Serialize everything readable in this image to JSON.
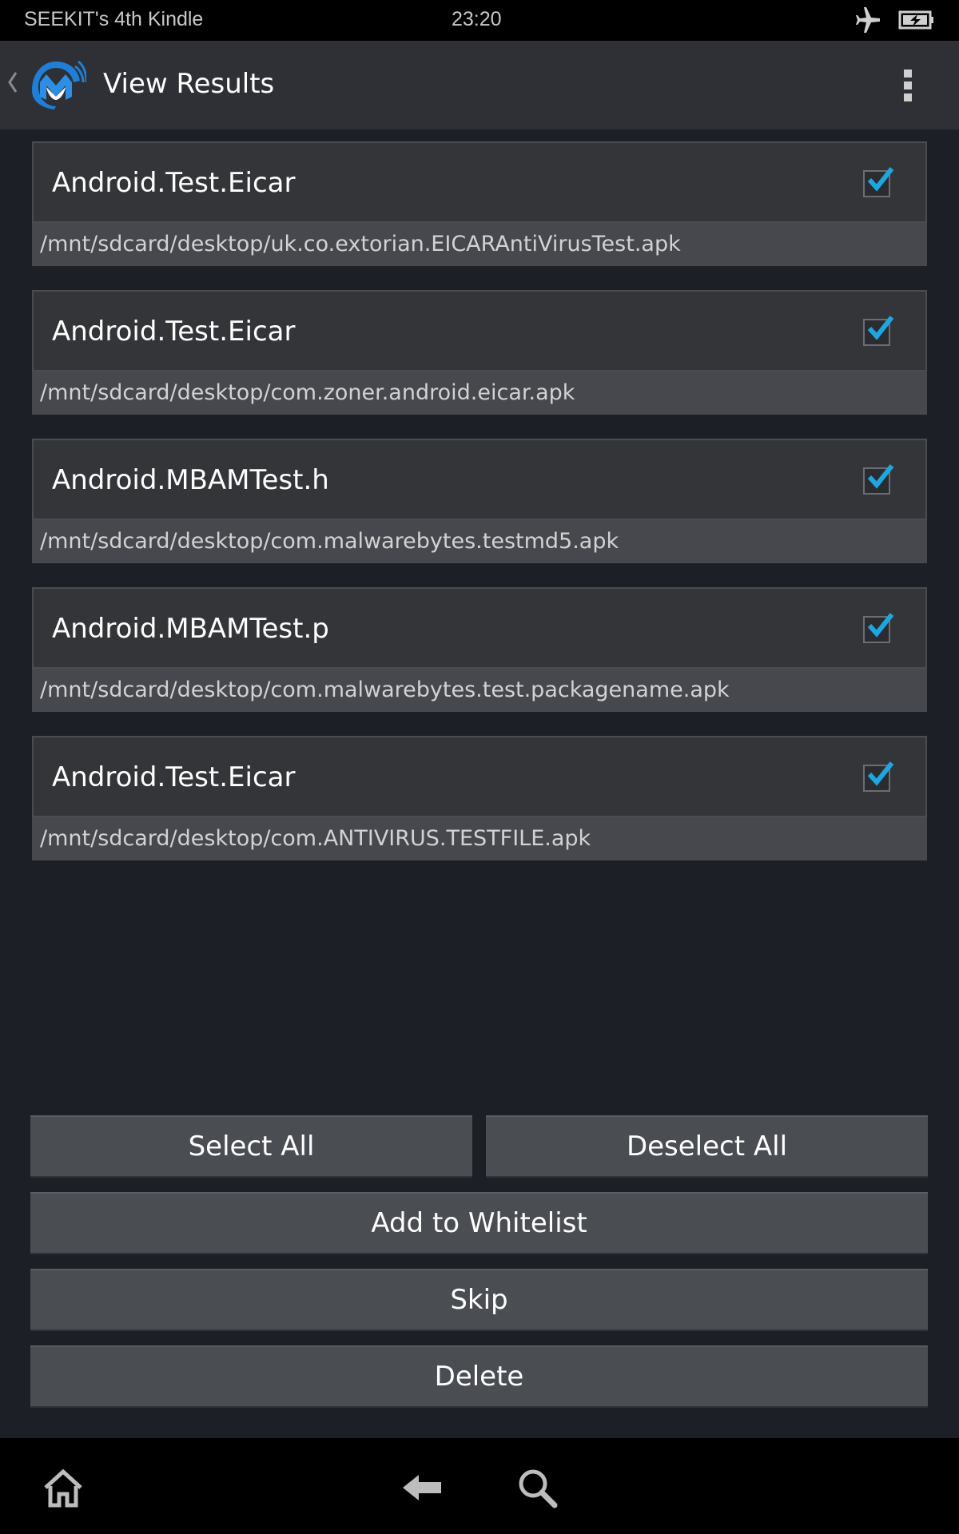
{
  "status_bar": {
    "device_name": "SEEKIT's 4th Kindle",
    "time": "23:20",
    "icons": [
      "airplane-mode-icon",
      "battery-charging-icon"
    ]
  },
  "action_bar": {
    "title": "View Results",
    "icons": [
      "back-chevron-icon",
      "malwarebytes-logo",
      "overflow-menu-icon"
    ]
  },
  "results": [
    {
      "name": "Android.Test.Eicar",
      "path": "/mnt/sdcard/desktop/uk.co.extorian.EICARAntiVirusTest.apk",
      "checked": true
    },
    {
      "name": "Android.Test.Eicar",
      "path": "/mnt/sdcard/desktop/com.zoner.android.eicar.apk",
      "checked": true
    },
    {
      "name": "Android.MBAMTest.h",
      "path": "/mnt/sdcard/desktop/com.malwarebytes.testmd5.apk",
      "checked": true
    },
    {
      "name": "Android.MBAMTest.p",
      "path": "/mnt/sdcard/desktop/com.malwarebytes.test.packagename.apk",
      "checked": true
    },
    {
      "name": "Android.Test.Eicar",
      "path": "/mnt/sdcard/desktop/com.ANTIVIRUS.TESTFILE.apk",
      "checked": true
    }
  ],
  "buttons": {
    "select_all": "Select All",
    "deselect_all": "Deselect All",
    "add_to_whitelist": "Add to Whitelist",
    "skip": "Skip",
    "delete": "Delete"
  },
  "nav_bar": {
    "icons": [
      "home-icon",
      "back-arrow-icon",
      "search-icon"
    ]
  },
  "colors": {
    "checkmark": "#1ea6e0",
    "logo_blue": "#1f7fd6",
    "background": "#1c2026"
  }
}
